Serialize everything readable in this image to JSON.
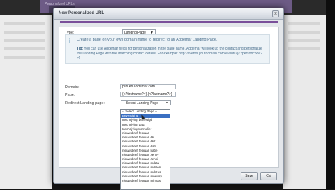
{
  "background": {
    "header_text": "Personalized URLs",
    "purple": "#6d5b86"
  },
  "dialog": {
    "title": "New Personalized URL",
    "close_glyph": "x",
    "accent": "#7a4f9a",
    "type": {
      "label": "Type:",
      "value": "Landing Page"
    },
    "info": {
      "line1": "Create a page on your own domain name to redirect to an Addemar Landing Page.",
      "tip_label": "Tip:",
      "tip_text": " You can use Addemar fields for personalization in the page name. Addemar will look up the contact and personalize the Landing Page with the matching contact details. For example: http://events.yourdomain.com/event1/{<?personcode?>}"
    },
    "domain": {
      "label": "Domain:",
      "value": "purl.en.addemar.com"
    },
    "page": {
      "label": "Page:",
      "value": "{<?firstname?>}.{<?lastname?>}"
    },
    "redirect": {
      "label": "Redirect Landing page:",
      "value": "-- Select Landing Page --",
      "options": [
        "-- Select Landing Page --",
        "Bevestiging",
        "Inschrijving bevestigd",
        "Inschrijving data",
        "Inschrijvingsformulier",
        "nieuwsbrief februari",
        "nieuwsbrief februari dk",
        "nieuwsbrief februari dkit",
        "nieuwsbrief februari data",
        "nieuwsbrief februari babe",
        "nieuwsbrief februari Jenny",
        "nieuwsbrief februari Jenni",
        "nieuwsbrief februari mdata",
        "nieuwsbrief februari mdalen",
        "nieuwsbrief februari mdataa",
        "nieuwsbrief februari mnewsy",
        "nieuwsbrief februari mjmuts"
      ],
      "selected_index": 1
    },
    "save_label": "Save",
    "cancel_label": "Cal"
  }
}
